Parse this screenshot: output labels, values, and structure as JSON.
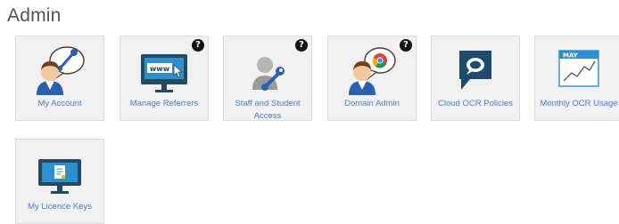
{
  "page": {
    "title": "Admin"
  },
  "tiles": [
    {
      "label": "My Account",
      "icon": "user-wrench-icon",
      "help": ""
    },
    {
      "label": "Manage Referrers",
      "icon": "www-monitor-icon",
      "help": "?"
    },
    {
      "label": "Staff and Student Access",
      "icon": "gray-user-wrench-icon",
      "help": "?"
    },
    {
      "label": "Domain Admin",
      "icon": "user-chrome-icon",
      "help": "?"
    },
    {
      "label": "Cloud OCR Policies",
      "icon": "speech-bubble-icon",
      "help": ""
    },
    {
      "label": "Monthly OCR Usage",
      "icon": "calendar-chart-icon",
      "month": "MAY",
      "help": ""
    },
    {
      "label": "My Licence Keys",
      "icon": "licence-monitor-icon",
      "help": ""
    }
  ],
  "colors": {
    "link": "#4a7fd8",
    "tile_bg": "#f1f1f1",
    "accent": "#29a8e0",
    "dark": "#234a5e"
  }
}
